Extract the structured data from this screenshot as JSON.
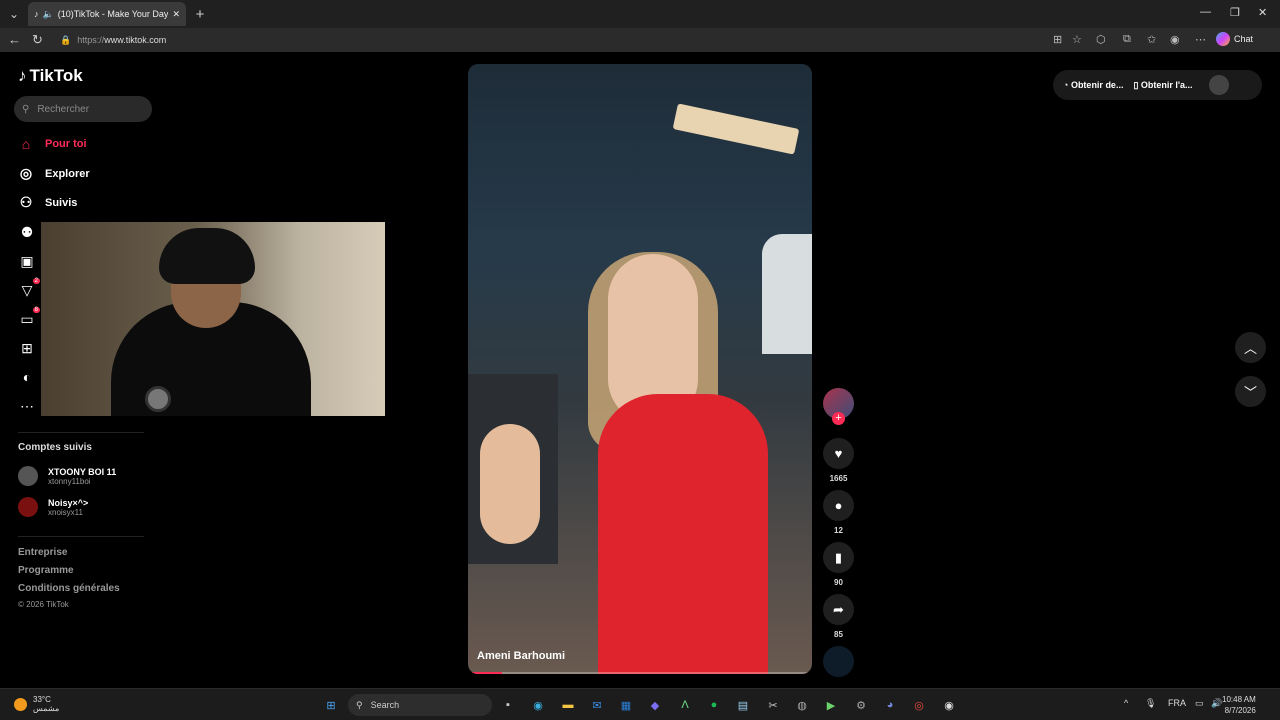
{
  "browser": {
    "tab_title": "(10)TikTok - Make Your Day",
    "url_protocol": "https://",
    "url_host": "www.tiktok.com",
    "chat_label": "Chat"
  },
  "tiktok": {
    "logo_text": "TikTok",
    "search_placeholder": "Rechercher",
    "menu": [
      {
        "label": "Pour toi",
        "icon": "home-icon",
        "active": true
      },
      {
        "label": "Explorer",
        "icon": "compass-icon"
      },
      {
        "label": "Suivis",
        "icon": "following-icon"
      }
    ],
    "side_icons": [
      {
        "icon": "friends-icon"
      },
      {
        "icon": "live-icon"
      },
      {
        "icon": "activity-icon",
        "badge": "2"
      },
      {
        "icon": "messages-icon",
        "badge": "8"
      },
      {
        "icon": "upload-icon"
      },
      {
        "icon": "profile-icon"
      },
      {
        "icon": "more-icon"
      }
    ],
    "followed_title": "Comptes suivis",
    "followed": [
      {
        "name": "XTOONY BOI 11",
        "handle": "xtonny11boi"
      },
      {
        "name": "Noisy×^>",
        "handle": "xnoisyx11"
      }
    ],
    "footer": [
      "Entreprise",
      "Programme",
      "Conditions générales"
    ],
    "copyright": "© 2026 TikTok",
    "video": {
      "author": "Ameni Barhoumi",
      "progress": 0.1,
      "likes": "1665",
      "comments": "12",
      "saves": "90",
      "shares": "85"
    },
    "top_actions": {
      "get_coins": "Obtenir de...",
      "get_app": "Obtenir l'a..."
    }
  },
  "taskbar": {
    "temp": "33°C",
    "weather_desc": "مشمس",
    "search_label": "Search",
    "lang": "FRA",
    "time": "10:48 AM",
    "date": "8/7/2026"
  }
}
